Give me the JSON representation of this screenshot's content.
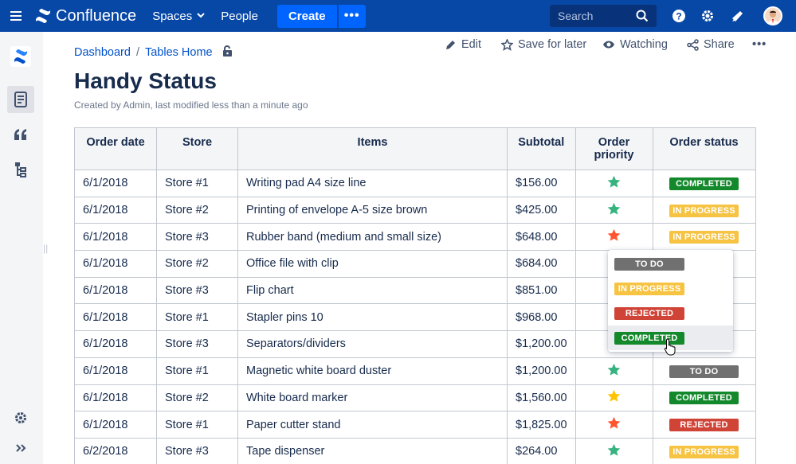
{
  "topnav": {
    "app_name": "Confluence",
    "spaces_label": "Spaces",
    "people_label": "People",
    "create_label": "Create",
    "more_label": "•••",
    "search_placeholder": "Search",
    "brand_color": "#0747a6"
  },
  "breadcrumb": {
    "items": [
      "Dashboard",
      "Tables Home"
    ],
    "separator": "/"
  },
  "actions": {
    "edit": "Edit",
    "save_for_later": "Save for later",
    "watching": "Watching",
    "share": "Share",
    "more": "•••"
  },
  "page": {
    "title": "Handy Status",
    "byline": "Created by Admin, last modified less than a minute ago"
  },
  "table": {
    "headers": [
      "Order date",
      "Store",
      "Items",
      "Subtotal",
      "Order priority",
      "Order status"
    ],
    "rows": [
      {
        "date": "6/1/2018",
        "store": "Store #1",
        "item": "Writing pad A4 size line",
        "subtotal": "$156.00",
        "priority": "green",
        "status": "COMPLETED"
      },
      {
        "date": "6/1/2018",
        "store": "Store #2",
        "item": "Printing of envelope A-5 size brown",
        "subtotal": "$425.00",
        "priority": "green",
        "status": "IN PROGRESS"
      },
      {
        "date": "6/1/2018",
        "store": "Store #3",
        "item": "Rubber band (medium and small size)",
        "subtotal": "$648.00",
        "priority": "red",
        "status": "IN PROGRESS"
      },
      {
        "date": "6/1/2018",
        "store": "Store #2",
        "item": "Office file with clip",
        "subtotal": "$684.00",
        "priority": "yellow",
        "status": ""
      },
      {
        "date": "6/1/2018",
        "store": "Store #3",
        "item": "Flip chart",
        "subtotal": "$851.00",
        "priority": "green",
        "status": ""
      },
      {
        "date": "6/1/2018",
        "store": "Store #1",
        "item": "Stapler pins 10",
        "subtotal": "$968.00",
        "priority": "red",
        "status": ""
      },
      {
        "date": "6/1/2018",
        "store": "Store #3",
        "item": "Separators/dividers",
        "subtotal": "$1,200.00",
        "priority": "yellow",
        "status": ""
      },
      {
        "date": "6/1/2018",
        "store": "Store #1",
        "item": "Magnetic white board duster",
        "subtotal": "$1,200.00",
        "priority": "green",
        "status": "TO DO"
      },
      {
        "date": "6/1/2018",
        "store": "Store #2",
        "item": "White board marker",
        "subtotal": "$1,560.00",
        "priority": "yellow",
        "status": "COMPLETED"
      },
      {
        "date": "6/1/2018",
        "store": "Store #1",
        "item": "Paper cutter stand",
        "subtotal": "$1,825.00",
        "priority": "red",
        "status": "REJECTED"
      },
      {
        "date": "6/2/2018",
        "store": "Store #3",
        "item": "Tape dispenser",
        "subtotal": "$264.00",
        "priority": "green",
        "status": "IN PROGRESS"
      }
    ]
  },
  "dropdown": {
    "options": [
      "TO DO",
      "IN PROGRESS",
      "REJECTED",
      "COMPLETED"
    ],
    "hovered": "COMPLETED"
  },
  "colors": {
    "star_green": "#36b37e",
    "star_yellow": "#ffc400",
    "star_red": "#ff5630",
    "status_completed": "#14892c",
    "status_in_progress": "#f6c342",
    "status_todo": "#707070",
    "status_rejected": "#d04437"
  }
}
